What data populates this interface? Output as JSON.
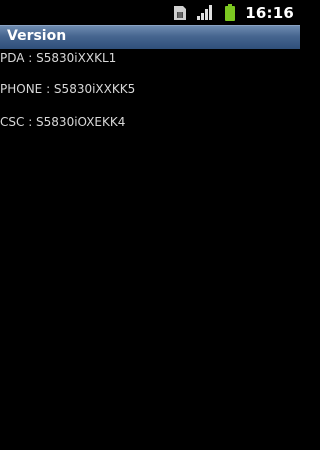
{
  "status_bar": {
    "time": "16:16",
    "icons": [
      "sim-card-icon",
      "signal-strength-icon",
      "battery-icon"
    ],
    "battery_color": "#7cc821"
  },
  "title_bar": {
    "title": "Version"
  },
  "version_info": [
    {
      "text": "PDA : S5830iXXKL1"
    },
    {
      "text": "PHONE : S5830iXXKK5"
    },
    {
      "text": "CSC : S5830iOXEKK4"
    }
  ]
}
